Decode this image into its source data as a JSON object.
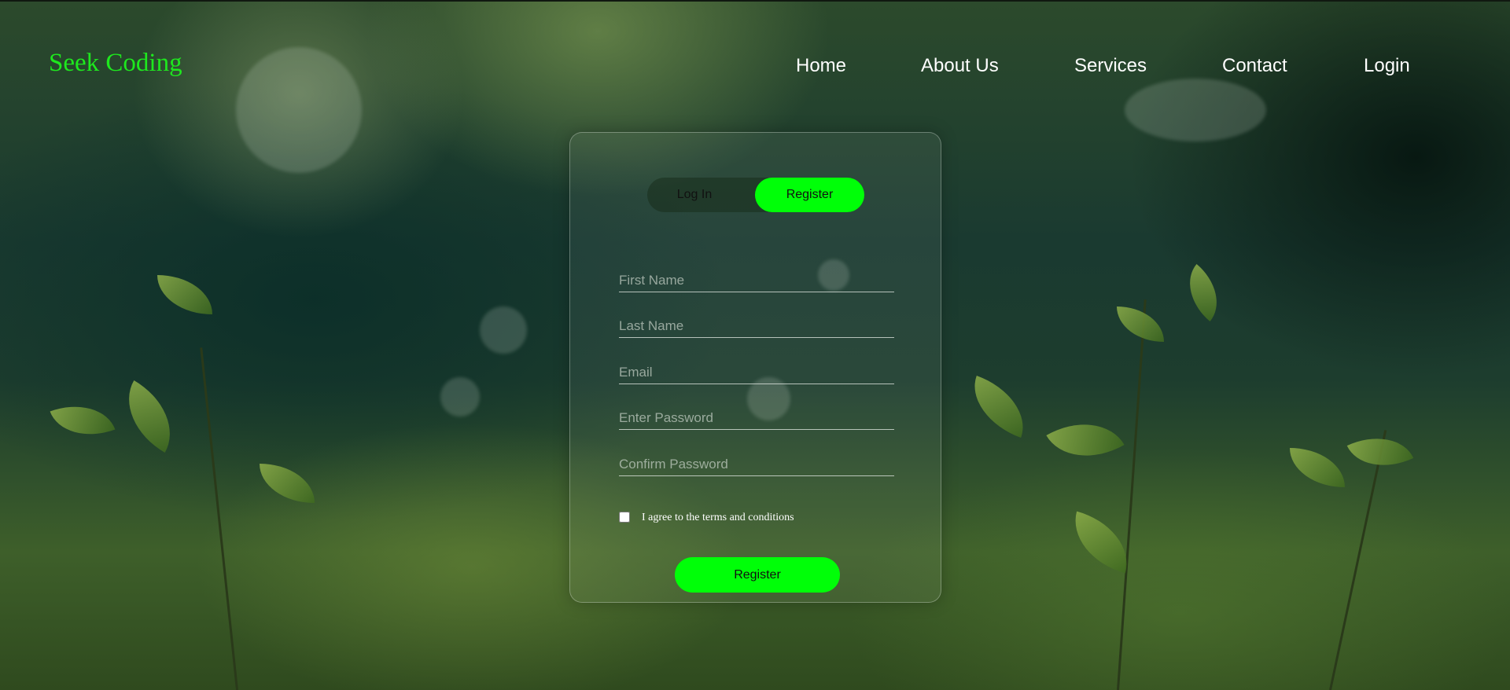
{
  "brand": {
    "logo": "Seek Coding",
    "accent": "#00ff08"
  },
  "nav": {
    "items": [
      {
        "label": "Home"
      },
      {
        "label": "About Us"
      },
      {
        "label": "Services"
      },
      {
        "label": "Contact"
      },
      {
        "label": "Login"
      }
    ]
  },
  "form": {
    "tabs": {
      "login": "Log In",
      "register": "Register",
      "active": "Register"
    },
    "fields": {
      "first_name": "First Name",
      "last_name": "Last Name",
      "email": "Email",
      "password": "Enter Password",
      "confirm_password": "Confirm Password"
    },
    "terms_label": "I agree to the terms and conditions",
    "terms_checked": false,
    "submit_label": "Register"
  }
}
